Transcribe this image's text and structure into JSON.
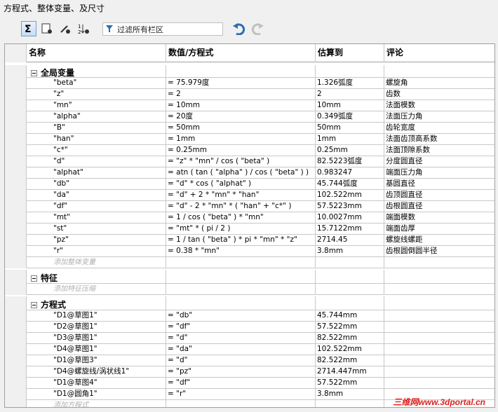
{
  "window": {
    "title": "方程式、整体变量、及尺寸"
  },
  "toolbar": {
    "filter_placeholder": "过滤所有栏区",
    "buttons": [
      "sum-view",
      "sheet-view",
      "dimension-view",
      "order-view",
      "undo",
      "redo"
    ]
  },
  "columns": [
    "名称",
    "数值/方程式",
    "估算到",
    "评论"
  ],
  "sections": {
    "globals": {
      "label": "全局变量",
      "add_label": "添加整体变量",
      "rows": [
        {
          "name": "\"beta\"",
          "value": "= 75.979度",
          "eval": "1.326弧度",
          "comment": "螺旋角"
        },
        {
          "name": "\"z\"",
          "value": "= 2",
          "eval": "2",
          "comment": "齿数"
        },
        {
          "name": "\"mn\"",
          "value": "= 10mm",
          "eval": "10mm",
          "comment": "法面模数"
        },
        {
          "name": "\"alpha\"",
          "value": "= 20度",
          "eval": "0.349弧度",
          "comment": "法面压力角"
        },
        {
          "name": "\"B\"",
          "value": "= 50mm",
          "eval": "50mm",
          "comment": "齿轮宽度"
        },
        {
          "name": "\"han\"",
          "value": "= 1mm",
          "eval": "1mm",
          "comment": "法面齿顶高系数"
        },
        {
          "name": "\"c*\"",
          "value": "= 0.25mm",
          "eval": "0.25mm",
          "comment": "法面顶隙系数"
        },
        {
          "name": "\"d\"",
          "value": "= \"z\" * \"mn\" / cos ( \"beta\" )",
          "eval": "82.5223弧度",
          "comment": "分度圆直径"
        },
        {
          "name": "\"alphat\"",
          "value": "= atn ( tan ( \"alpha\" ) / cos ( \"beta\" ) )",
          "eval": "0.983247",
          "comment": "端面压力角"
        },
        {
          "name": "\"db\"",
          "value": "= \"d\" * cos ( \"alphat\" )",
          "eval": "45.744弧度",
          "comment": "基圆直径"
        },
        {
          "name": "\"da\"",
          "value": "= \"d\" + 2 * \"mn\" * \"han\"",
          "eval": "102.522mm",
          "comment": "齿顶圆直径"
        },
        {
          "name": "\"df\"",
          "value": "= \"d\" - 2 * \"mn\" * ( \"han\" + \"c*\" )",
          "eval": "57.5223mm",
          "comment": "齿根圆直径"
        },
        {
          "name": "\"mt\"",
          "value": "= 1 / cos ( \"beta\" ) * \"mn\"",
          "eval": "10.0027mm",
          "comment": "端面模数"
        },
        {
          "name": "\"st\"",
          "value": "= \"mt\" * ( pi / 2 )",
          "eval": "15.7122mm",
          "comment": "端面齿厚"
        },
        {
          "name": "\"pz\"",
          "value": "= 1 / tan ( \"beta\" ) * pi * \"mn\" * \"z\"",
          "eval": "2714.45",
          "comment": "螺旋线螺距"
        },
        {
          "name": "\"r\"",
          "value": "= 0.38 * \"mn\"",
          "eval": "3.8mm",
          "comment": "齿根圆倒圆半径"
        }
      ]
    },
    "features": {
      "label": "特征",
      "add_label": "添加特征压缩"
    },
    "equations": {
      "label": "方程式",
      "add_label": "添加方程式",
      "rows": [
        {
          "name": "\"D1@草图1\"",
          "value": "= \"db\"",
          "eval": "45.744mm",
          "comment": ""
        },
        {
          "name": "\"D2@草图1\"",
          "value": "= \"df\"",
          "eval": "57.522mm",
          "comment": ""
        },
        {
          "name": "\"D3@草图1\"",
          "value": "= \"d\"",
          "eval": "82.522mm",
          "comment": ""
        },
        {
          "name": "\"D4@草图1\"",
          "value": "= \"da\"",
          "eval": "102.522mm",
          "comment": ""
        },
        {
          "name": "\"D1@草图3\"",
          "value": "= \"d\"",
          "eval": "82.522mm",
          "comment": ""
        },
        {
          "name": "\"D4@螺旋线/涡状线1\"",
          "value": "= \"pz\"",
          "eval": "2714.447mm",
          "comment": ""
        },
        {
          "name": "\"D1@草图4\"",
          "value": "= \"df\"",
          "eval": "57.522mm",
          "comment": ""
        },
        {
          "name": "\"D1@圆角1\"",
          "value": "= \"r\"",
          "eval": "3.8mm",
          "comment": ""
        }
      ]
    }
  },
  "watermark": "三维网www.3dportal.cn"
}
